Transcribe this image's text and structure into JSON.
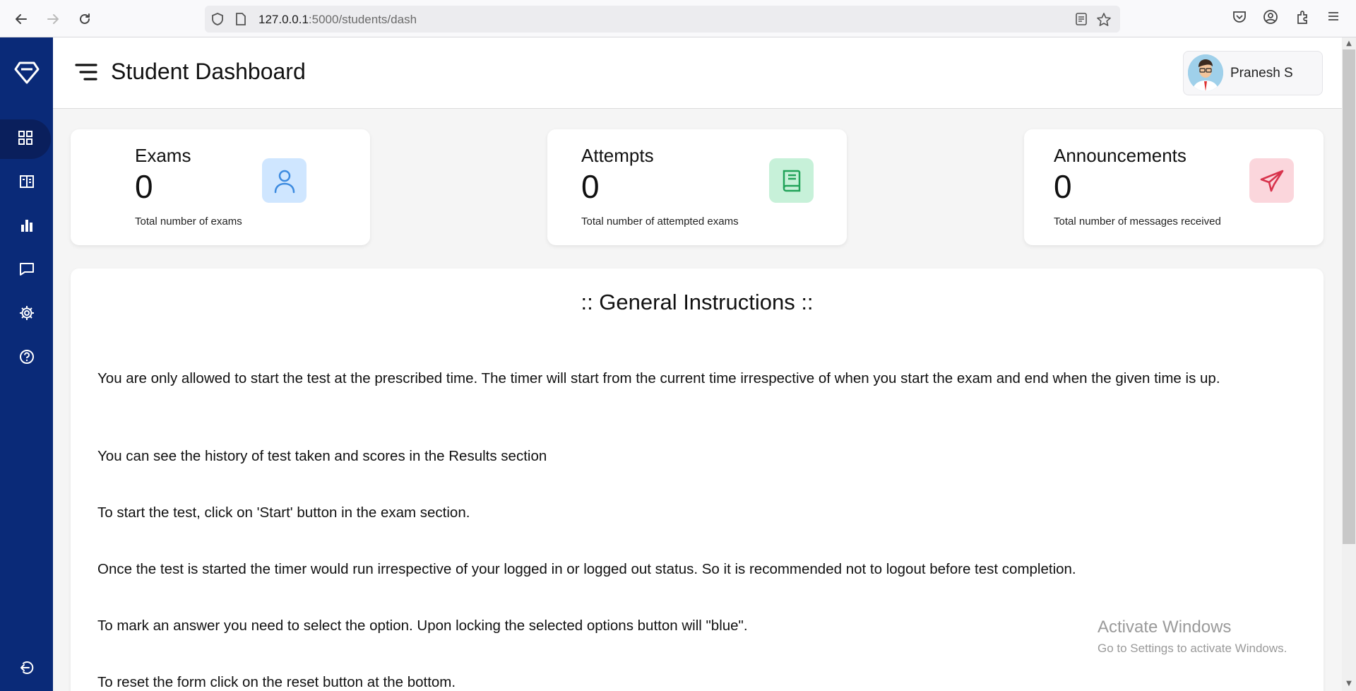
{
  "browser": {
    "url_host": "127.0.0.1",
    "url_path": ":5000/students/dash"
  },
  "header": {
    "title": "Student Dashboard",
    "user_name": "Pranesh S"
  },
  "sidebar": {
    "items": [
      {
        "icon": "dashboard-icon",
        "active": true
      },
      {
        "icon": "book-open-icon",
        "active": false
      },
      {
        "icon": "bar-chart-icon",
        "active": false
      },
      {
        "icon": "message-icon",
        "active": false
      },
      {
        "icon": "gear-icon",
        "active": false
      },
      {
        "icon": "help-icon",
        "active": false
      }
    ],
    "logout_icon": "logout-icon"
  },
  "cards": [
    {
      "title": "Exams",
      "value": "0",
      "subtitle": "Total number of exams",
      "icon": "user-icon",
      "icon_bg": "#cfe6ff",
      "icon_color": "#3d8be0"
    },
    {
      "title": "Attempts",
      "value": "0",
      "subtitle": "Total number of attempted exams",
      "icon": "book-icon",
      "icon_bg": "#c7f1d9",
      "icon_color": "#22a35a"
    },
    {
      "title": "Announcements",
      "value": "0",
      "subtitle": "Total number of messages received",
      "icon": "send-icon",
      "icon_bg": "#fbd6dc",
      "icon_color": "#d8344d"
    }
  ],
  "instructions": {
    "title": ":: General Instructions ::",
    "items": [
      "You are only allowed to start the test at the prescribed time. The timer will start from the current time irrespective of when you start the exam and end when the given time is up.",
      "You can see the history of test taken and scores in the Results section",
      "To start the test, click on 'Start' button in the exam section.",
      "Once the test is started the timer would run irrespective of your logged in or logged out status. So it is recommended not to logout before test completion.",
      "To mark an answer you need to select the option. Upon locking the selected options button will \"blue\".",
      "To reset the form click on the reset button at the bottom."
    ]
  },
  "watermark": {
    "title": "Activate Windows",
    "subtitle": "Go to Settings to activate Windows."
  },
  "colors": {
    "sidebar": "#0a2a78",
    "sidebar_active": "#0a1f5c"
  }
}
